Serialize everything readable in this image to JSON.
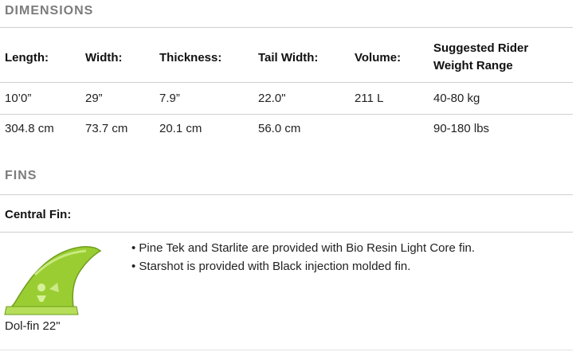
{
  "dimensions": {
    "title": "DIMENSIONS",
    "headers": [
      "Length:",
      "Width:",
      "Thickness:",
      "Tail Width:",
      "Volume:",
      "Suggested Rider",
      "Weight Range"
    ],
    "rows": [
      [
        "10’0”",
        "29”",
        "7.9”",
        "22.0\"",
        "211 L",
        "40-80 kg"
      ],
      [
        "304.8 cm",
        "73.7 cm",
        "20.1 cm",
        "56.0 cm",
        "",
        "90-180 lbs"
      ]
    ]
  },
  "fins": {
    "title": "FINS",
    "central_label": "Central Fin:",
    "bullets": [
      "• Pine Tek and Starlite are provided with Bio Resin Light Core fin.",
      "• Starshot is provided with Black injection molded fin."
    ],
    "fin_caption": "Dol-fin 22\"",
    "fin_color": "#9acd32"
  }
}
